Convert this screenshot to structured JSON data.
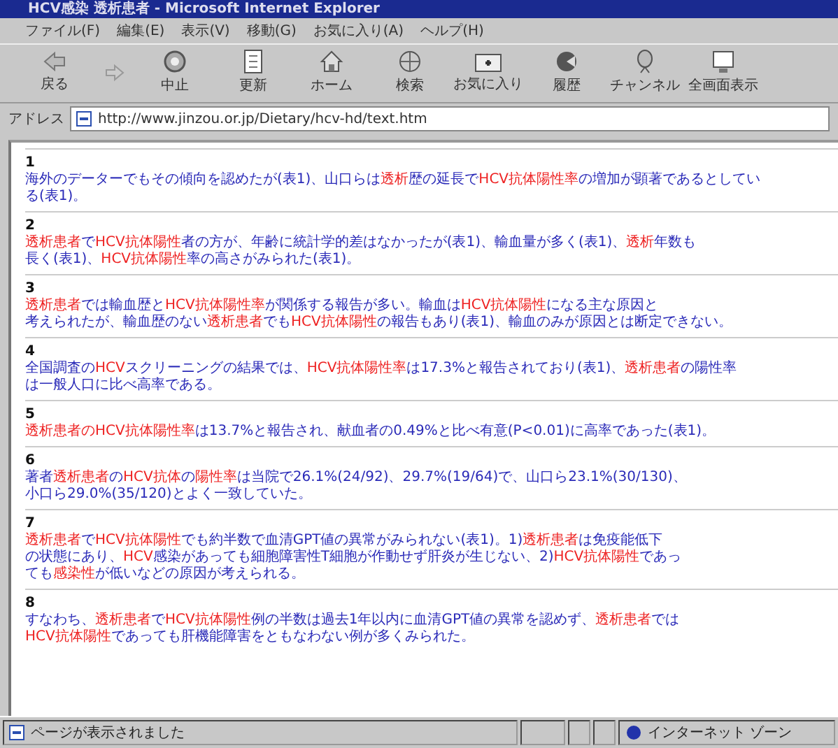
{
  "window": {
    "title": "HCV感染 透析患者 - Microsoft Internet Explorer"
  },
  "menu": [
    "ファイル(F)",
    "編集(E)",
    "表示(V)",
    "移動(G)",
    "お気に入り(A)",
    "ヘルプ(H)"
  ],
  "toolbar": [
    {
      "kind": "back",
      "label": "戻る"
    },
    {
      "kind": "forward"
    },
    {
      "kind": "stop",
      "label": "中止"
    },
    {
      "kind": "refresh",
      "label": "更新"
    },
    {
      "kind": "home",
      "label": "ホーム"
    },
    {
      "kind": "search",
      "label": "検索"
    },
    {
      "kind": "favorites",
      "label": "お気に入り"
    },
    {
      "kind": "history",
      "label": "履歴"
    },
    {
      "kind": "channels",
      "label": "チャンネル"
    },
    {
      "kind": "fullscreen",
      "label": "全画面表示"
    }
  ],
  "address": {
    "label": "アドレス",
    "value": "http://www.jinzou.or.jp/Dietary/hcv-hd/text.htm"
  },
  "items": [
    {
      "number": "1",
      "lines": [
        [
          {
            "kind": "plain",
            "text": "海外のデーターでもその傾向を認めたが(表1)、山口らは"
          },
          {
            "kind": "red",
            "text": "透析"
          },
          {
            "kind": "plain",
            "text": "歴の延長で"
          },
          {
            "kind": "red",
            "text": "HCV抗体陽性率"
          },
          {
            "kind": "plain",
            "text": "の増加が顕著であるとしてい"
          }
        ],
        [
          {
            "kind": "plain",
            "text": "る(表1)。"
          }
        ]
      ]
    },
    {
      "number": "2",
      "lines": [
        [
          {
            "kind": "red",
            "text": "透析患者"
          },
          {
            "kind": "plain",
            "text": "で"
          },
          {
            "kind": "red",
            "text": "HCV抗体陽性"
          },
          {
            "kind": "plain",
            "text": "者の方が、年齢に統計学的差はなかったが(表1)、輸血量が多く(表1)、"
          },
          {
            "kind": "red",
            "text": "透析"
          },
          {
            "kind": "plain",
            "text": "年数も"
          }
        ],
        [
          {
            "kind": "plain",
            "text": "長く(表1)、"
          },
          {
            "kind": "red",
            "text": "HCV抗体陽性"
          },
          {
            "kind": "plain",
            "text": "率の高さがみられた(表1)。"
          }
        ]
      ]
    },
    {
      "number": "3",
      "lines": [
        [
          {
            "kind": "red",
            "text": "透析患者"
          },
          {
            "kind": "plain",
            "text": "では輸血歴と"
          },
          {
            "kind": "red",
            "text": "HCV抗体陽性率"
          },
          {
            "kind": "plain",
            "text": "が関係する報告が多い。輸血は"
          },
          {
            "kind": "red",
            "text": "HCV抗体陽性"
          },
          {
            "kind": "plain",
            "text": "になる主な原因と"
          }
        ],
        [
          {
            "kind": "plain",
            "text": "考えられたが、輸血歴のない"
          },
          {
            "kind": "red",
            "text": "透析患者"
          },
          {
            "kind": "plain",
            "text": "でも"
          },
          {
            "kind": "red",
            "text": "HCV抗体陽性"
          },
          {
            "kind": "plain",
            "text": "の報告もあり(表1)、輸血のみが原因とは断定できない。"
          }
        ]
      ]
    },
    {
      "number": "4",
      "lines": [
        [
          {
            "kind": "plain",
            "text": "全国調査の"
          },
          {
            "kind": "red",
            "text": "HCV"
          },
          {
            "kind": "plain",
            "text": "スクリーニングの結果では、"
          },
          {
            "kind": "red",
            "text": "HCV抗体陽性率"
          },
          {
            "kind": "plain",
            "text": "は17.3%と報告されており(表1)、"
          },
          {
            "kind": "red",
            "text": "透析患者"
          },
          {
            "kind": "plain",
            "text": "の陽性率"
          }
        ],
        [
          {
            "kind": "plain",
            "text": "は一般人口に比べ高率である。"
          }
        ]
      ]
    },
    {
      "number": "5",
      "lines": [
        [
          {
            "kind": "red",
            "text": "透析患者のHCV抗体陽性率"
          },
          {
            "kind": "plain",
            "text": "は13.7%と報告され、献血者の0.49%と比べ有意(P<0.01)に高率であった(表1)。"
          }
        ]
      ]
    },
    {
      "number": "6",
      "lines": [
        [
          {
            "kind": "plain",
            "text": "著者"
          },
          {
            "kind": "red",
            "text": "透析患者"
          },
          {
            "kind": "plain",
            "text": "の"
          },
          {
            "kind": "red",
            "text": "HCV抗体"
          },
          {
            "kind": "plain",
            "text": "の"
          },
          {
            "kind": "red",
            "text": "陽性率"
          },
          {
            "kind": "plain",
            "text": "は当院で26.1%(24/92)、29.7%(19/64)で、山口ら23.1%(30/130)、"
          }
        ],
        [
          {
            "kind": "plain",
            "text": "小口ら29.0%(35/120)とよく一致していた。"
          }
        ]
      ]
    },
    {
      "number": "7",
      "lines": [
        [
          {
            "kind": "red",
            "text": "透析患者"
          },
          {
            "kind": "plain",
            "text": "で"
          },
          {
            "kind": "red",
            "text": "HCV抗体陽性"
          },
          {
            "kind": "plain",
            "text": "でも約半数で血清GPT値の異常がみられない(表1)。1)"
          },
          {
            "kind": "red",
            "text": "透析患者"
          },
          {
            "kind": "plain",
            "text": "は免疫能低下"
          }
        ],
        [
          {
            "kind": "plain",
            "text": "の状態にあり、"
          },
          {
            "kind": "red",
            "text": "HCV"
          },
          {
            "kind": "plain",
            "text": "感染があっても細胞障害性T細胞が作動せず肝炎が生じない、2)"
          },
          {
            "kind": "red",
            "text": "HCV抗体陽性"
          },
          {
            "kind": "plain",
            "text": "であっ"
          }
        ],
        [
          {
            "kind": "plain",
            "text": "ても"
          },
          {
            "kind": "red",
            "text": "感染性"
          },
          {
            "kind": "plain",
            "text": "が低いなどの原因が考えられる。"
          }
        ]
      ]
    },
    {
      "number": "8",
      "lines": [
        [
          {
            "kind": "plain",
            "text": "すなわち、"
          },
          {
            "kind": "red",
            "text": "透析患者"
          },
          {
            "kind": "plain",
            "text": "で"
          },
          {
            "kind": "red",
            "text": "HCV抗体陽性"
          },
          {
            "kind": "plain",
            "text": "例の半数は過去1年以内に血清GPT値の異常を認めず、"
          },
          {
            "kind": "red",
            "text": "透析患者"
          },
          {
            "kind": "plain",
            "text": "では"
          }
        ],
        [
          {
            "kind": "red",
            "text": "HCV抗体陽性"
          },
          {
            "kind": "plain",
            "text": "であっても肝機能障害をともなわない例が多くみられた。"
          }
        ]
      ]
    }
  ],
  "status_bar": {
    "text": "ページが表示されました",
    "zone": "インターネット ゾーン"
  }
}
